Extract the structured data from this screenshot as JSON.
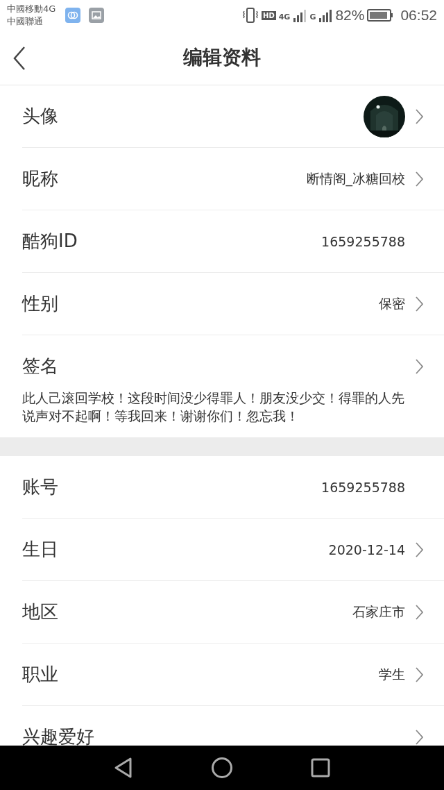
{
  "status_bar": {
    "carrier_1": "中國移動4G",
    "carrier_2": "中國聯通",
    "hd": "HD",
    "network_1": "4G",
    "network_2": "G",
    "battery": "82%",
    "time": "06:52"
  },
  "header": {
    "title": "编辑资料"
  },
  "sections": [
    {
      "rows": [
        {
          "kind": "avatar",
          "label": "头像",
          "arrow": true
        },
        {
          "kind": "value",
          "label": "昵称",
          "value": "断情阁_冰糖回校",
          "arrow": true
        },
        {
          "kind": "value",
          "label": "酷狗ID",
          "value": "1659255788",
          "arrow": false
        },
        {
          "kind": "value",
          "label": "性别",
          "value": "保密",
          "arrow": true
        },
        {
          "kind": "text",
          "label": "签名",
          "text": "此人己滚回学校！这段时间没少得罪人！朋友没少交！得罪的人先说声对不起啊！等我回来！谢谢你们！忽忘我！",
          "arrow": true
        }
      ]
    },
    {
      "rows": [
        {
          "kind": "value",
          "label": "账号",
          "value": "1659255788",
          "arrow": false
        },
        {
          "kind": "value",
          "label": "生日",
          "value": "2020-12-14",
          "arrow": true
        },
        {
          "kind": "value",
          "label": "地区",
          "value": "石家庄市",
          "arrow": true
        },
        {
          "kind": "value",
          "label": "职业",
          "value": "学生",
          "arrow": true
        },
        {
          "kind": "value",
          "label": "兴趣爱好",
          "arrow": true
        }
      ]
    }
  ]
}
